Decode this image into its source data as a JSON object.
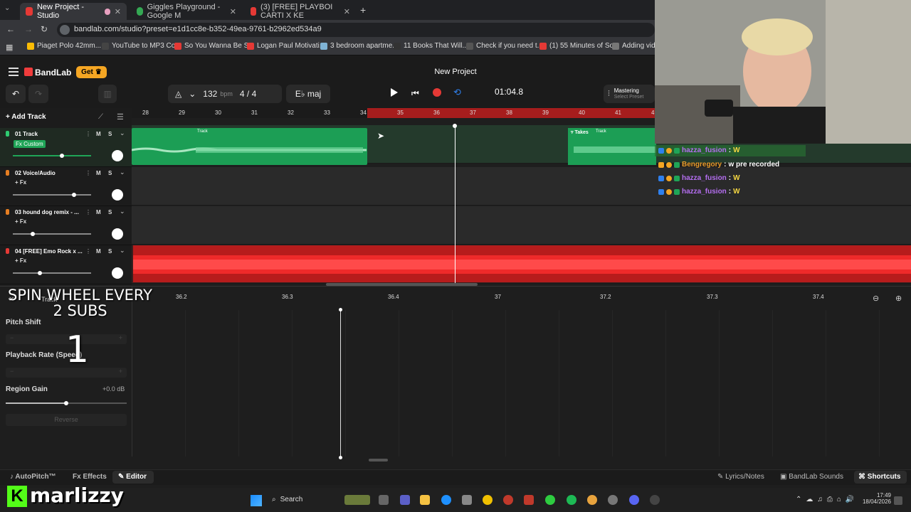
{
  "browser": {
    "tabs": [
      {
        "label": "New Project - Studio",
        "color": "#e53935"
      },
      {
        "label": "Giggles Playground - Google M",
        "color": "#34a853"
      },
      {
        "label": "(3) [FREE] PLAYBOI CARTI X KE",
        "color": "#e53935"
      }
    ],
    "url": "bandlab.com/studio?preset=e1d1cc8e-b352-49ea-9761-b2962ed534a9",
    "bookmarks": [
      "Piaget Polo 42mm...",
      "YouTube to MP3 Co...",
      "So You Wanna Be S...",
      "Logan Paul Motivati...",
      "3 bedroom apartme...",
      "11 Books That Will...",
      "Check if you need t...",
      "(1) 55 Minutes of So...",
      "Adding video"
    ]
  },
  "app": {
    "brand": "BandLab",
    "get_label": "Get",
    "project_title": "New Project",
    "bpm_value": "132",
    "bpm_unit": "bpm",
    "time_sig_num": "4",
    "time_sig_sep": "/",
    "time_sig_den": "4",
    "key": "E♭ maj",
    "time_display": "01:04.8",
    "mastering_label": "Mastering",
    "mastering_sub": "Select Preset",
    "add_track_label": "Add Track"
  },
  "ruler": {
    "marks": [
      "28",
      "29",
      "30",
      "31",
      "32",
      "33",
      "34",
      "35",
      "36",
      "37",
      "38",
      "39",
      "40",
      "41",
      "4"
    ]
  },
  "tracks": [
    {
      "name": "01  Track",
      "fx": "Fx Custom",
      "m": "M",
      "s": "S"
    },
    {
      "name": "02  Voice/Audio",
      "fx": "+ Fx",
      "m": "M",
      "s": "S"
    },
    {
      "name": "03  hound dog remix - ...",
      "fx": "+ Fx",
      "m": "M",
      "s": "S"
    },
    {
      "name": "04  [FREE] Emo Rock x ...",
      "fx": "+ Fx",
      "m": "M",
      "s": "S"
    }
  ],
  "regions": {
    "track_label": "Track",
    "takes_label": "Takes",
    "takes_track": "Track"
  },
  "editor": {
    "header": "Track",
    "pitch_shift": "Pitch Shift",
    "playback_rate": "Playback Rate (Speed)",
    "region_gain": "Region Gain",
    "gain_value": "+0.0 dB",
    "reverse": "Reverse",
    "ruler_marks": [
      "36.2",
      "36.3",
      "36.4",
      "37",
      "37.2",
      "37.3",
      "37.4"
    ]
  },
  "bottom": {
    "autopitch": "AutoPitch™",
    "effects": "Effects",
    "editor": "Editor",
    "lyrics": "Lyrics/Notes",
    "sounds": "BandLab Sounds",
    "shortcuts": "Shortcuts"
  },
  "chat": [
    {
      "user": "hazza_fusion",
      "msg": "W",
      "color": "#b46ef0"
    },
    {
      "user": "Bengregory",
      "msg": "w pre recorded",
      "color": "#e89c2a"
    },
    {
      "user": "hazza_fusion",
      "msg": "W",
      "color": "#b46ef0"
    },
    {
      "user": "hazza_fusion",
      "msg": "W",
      "color": "#b46ef0"
    }
  ],
  "overlay": {
    "line1": "SPIN WHEEL EVERY",
    "line2": "2 SUBS",
    "count": "1"
  },
  "stream": {
    "logo": "K",
    "name": "marlizzy"
  },
  "taskbar": {
    "search": "Search",
    "time": "17:49",
    "date": "18/04/2026"
  }
}
